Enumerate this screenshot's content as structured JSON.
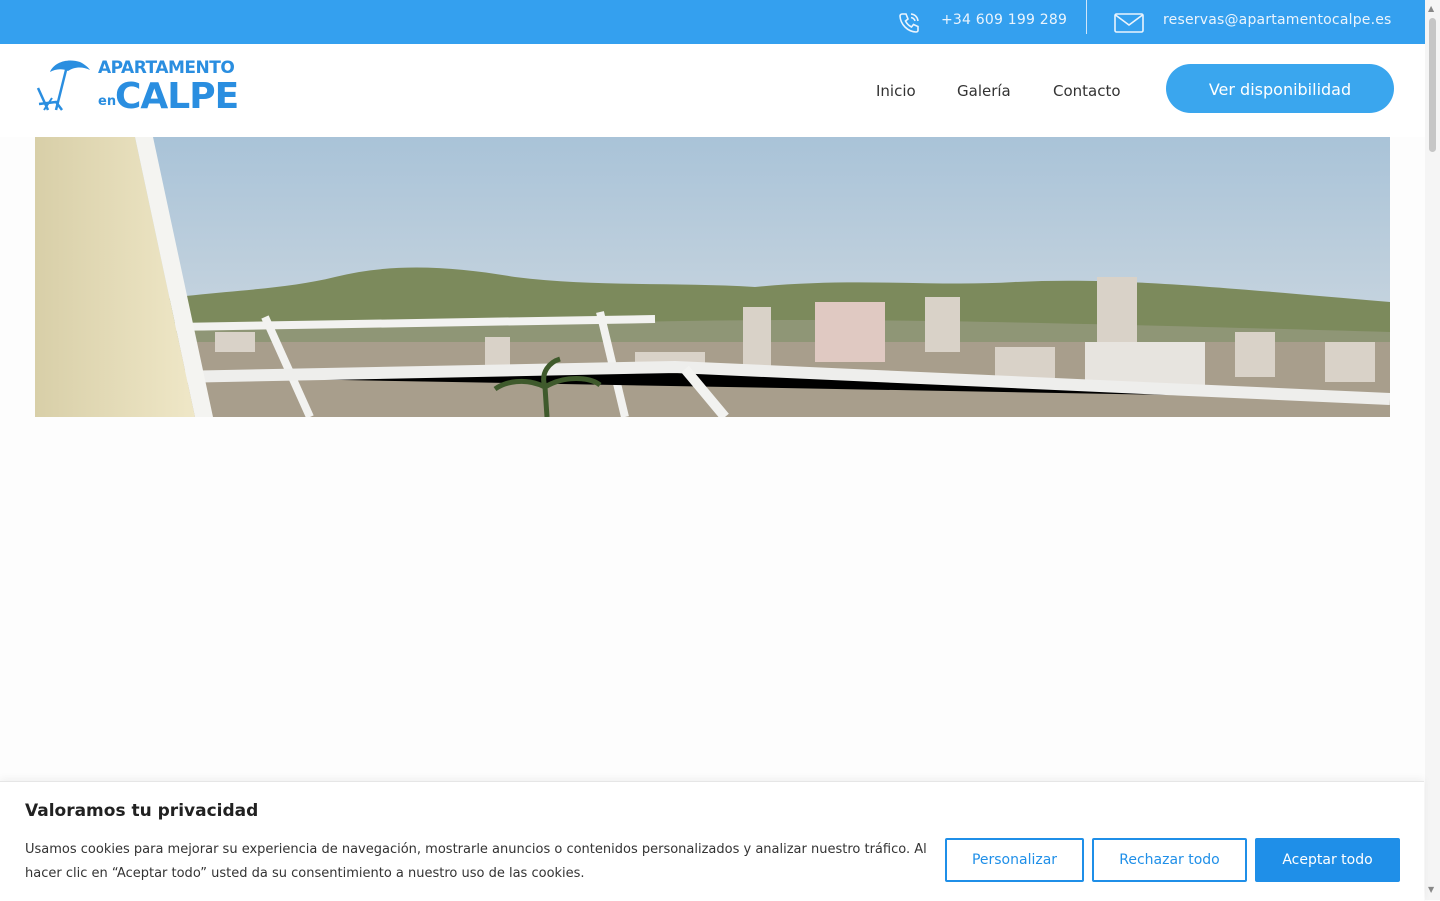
{
  "topbar": {
    "phone": "+34 609 199 289",
    "email": "reservas@apartamentocalpe.es",
    "phone_icon": "phone-icon",
    "mail_icon": "mail-icon",
    "background": "#34a0ef"
  },
  "logo": {
    "line1": "APARTAMENTO",
    "line2_small": "en",
    "line2_big": "CALPE",
    "color": "#2a8ee0"
  },
  "nav": {
    "inicio": "Inicio",
    "galeria": "Galería",
    "contacto": "Contacto",
    "cta": "Ver disponibilidad"
  },
  "cookie": {
    "title": "Valoramos tu privacidad",
    "text": "Usamos cookies para mejorar su experiencia de navegación, mostrarle anuncios o contenidos personalizados y analizar nuestro tráfico. Al hacer clic en “Aceptar todo” usted da su consentimiento a nuestro uso de las cookies.",
    "customize": "Personalizar",
    "reject": "Rechazar todo",
    "accept": "Aceptar todo",
    "accent": "#1f8fe8"
  }
}
